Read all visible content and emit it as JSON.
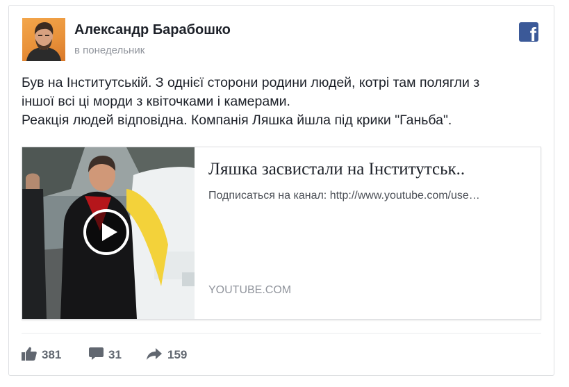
{
  "post": {
    "author": "Александр Барабошко",
    "time": "в понедельник",
    "text_lines": [
      "Був на Інститутській. З однієї сторони родини людей, котрі там полягли з",
      "іншої всі ці морди з квіточками і камерами.",
      "Реакція людей відповідна. Компанія Ляшка йшла під крики \"Ганьба\"."
    ]
  },
  "link": {
    "title": "Ляшка засвистали на Інститутськ..",
    "description": "Подписаться на канал: http://www.youtube.com/use…",
    "domain": "YOUTUBE.COM"
  },
  "stats": {
    "likes": "381",
    "comments": "31",
    "shares": "159"
  },
  "icons": {
    "brand": "facebook-logo-icon",
    "play": "play-icon",
    "like": "thumbs-up-icon",
    "comment": "comment-bubble-icon",
    "share": "share-arrow-icon"
  },
  "colors": {
    "brand": "#3b5998",
    "text": "#1d2129",
    "muted": "#90949c",
    "icon": "#616770"
  }
}
